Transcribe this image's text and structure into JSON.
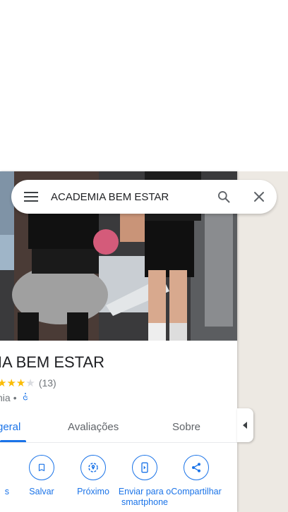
{
  "search": {
    "query": "ACADEMIA BEM ESTAR"
  },
  "place": {
    "title": "DEMIA BEM ESTAR",
    "rating_stars": 3,
    "review_count": "(13)",
    "category": "nia",
    "separator": "•"
  },
  "tabs": [
    {
      "label": "geral",
      "active": true
    },
    {
      "label": "Avaliações",
      "active": false
    },
    {
      "label": "Sobre",
      "active": false
    }
  ],
  "actions": [
    {
      "label": "s",
      "icon": "directions-icon"
    },
    {
      "label": "Salvar",
      "icon": "bookmark-icon"
    },
    {
      "label": "Próximo",
      "icon": "nearby-icon"
    },
    {
      "label": "Enviar para o smartphone",
      "icon": "send-to-phone-icon"
    },
    {
      "label": "Compartilhar",
      "icon": "share-icon"
    }
  ],
  "colors": {
    "accent": "#1a73e8",
    "star": "#fbbc04",
    "map": "#ede9e3"
  }
}
